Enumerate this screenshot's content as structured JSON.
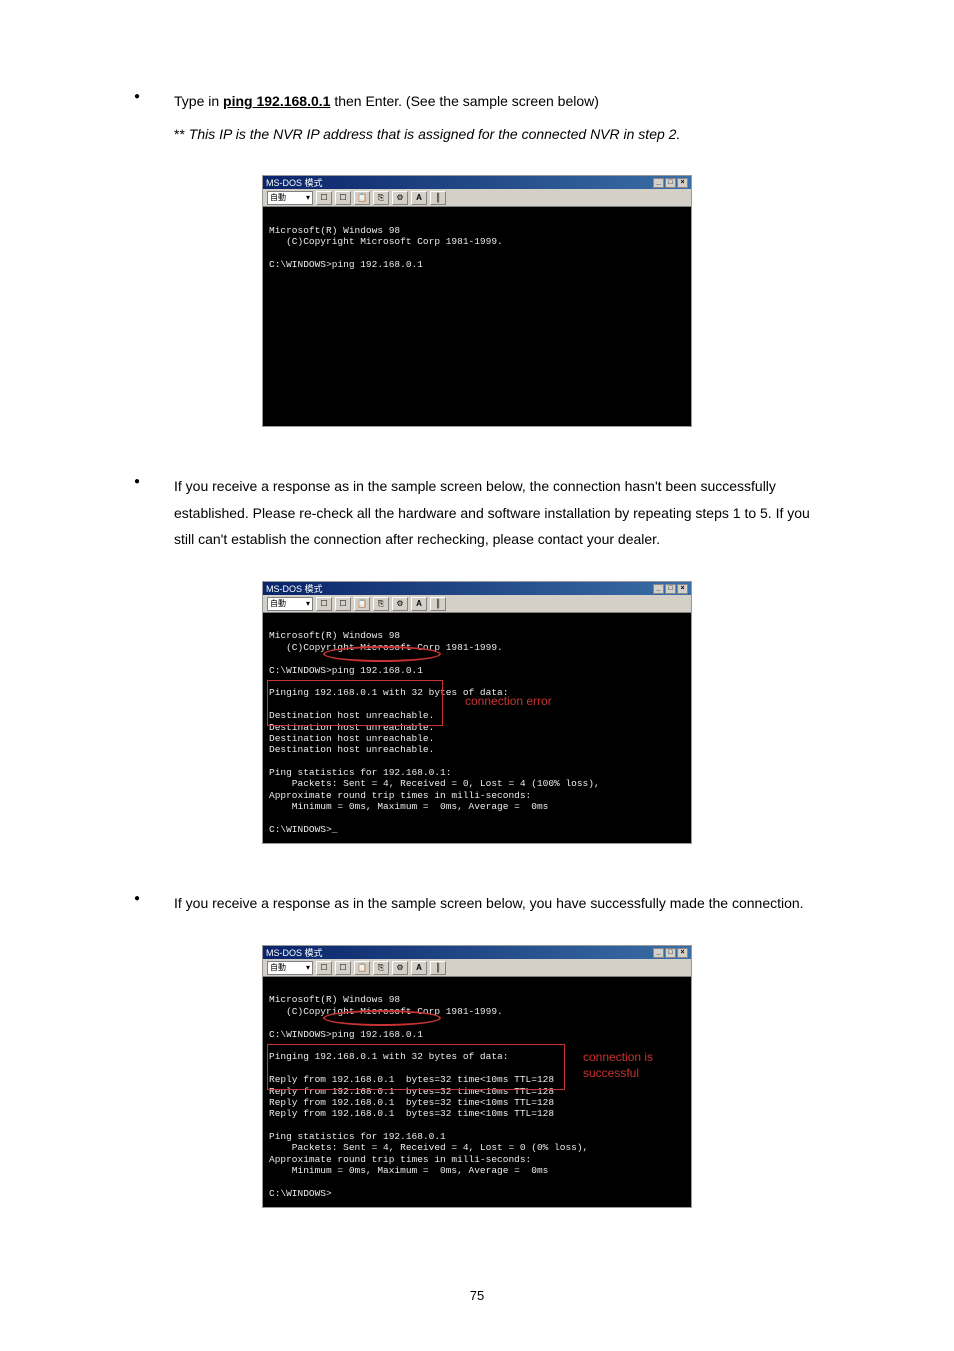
{
  "bullet1": {
    "prefix": "Type in ",
    "cmd": "ping 192.168.0.1",
    "suffix": " then Enter. (See the sample screen below)",
    "note_prefix": "** ",
    "note": "This IP is the NVR IP address that is assigned for the connected NVR in step 2."
  },
  "shot1": {
    "title": "MS-DOS 模式",
    "toolbar_sel": "自動",
    "body": "\nMicrosoft(R) Windows 98\n   (C)Copyright Microsoft Corp 1981-1999.\n\nC:\\WINDOWS>ping 192.168.0.1\n\n\n\n\n\n\n\n\n\n\n\n\n\n"
  },
  "bullet2": {
    "text": "If you receive a response as in the sample screen below, the connection hasn't been successfully established. Please re-check all the hardware and software installation by repeating steps 1 to 5. If you still can't establish the connection after rechecking, please contact your dealer."
  },
  "shot2": {
    "title": "MS-DOS 模式",
    "toolbar_sel": "自動",
    "body": "\nMicrosoft(R) Windows 98\n   (C)Copyright Microsoft Corp 1981-1999.\n\nC:\\WINDOWS>ping 192.168.0.1\n\nPinging 192.168.0.1 with 32 bytes of data:\n\nDestination host unreachable.\nDestination host unreachable.\nDestination host unreachable.\nDestination host unreachable.\n\nPing statistics for 192.168.0.1:\n    Packets: Sent = 4, Received = 0, Lost = 4 (100% loss),\nApproximate round trip times in milli-seconds:\n    Minimum = 0ms, Maximum =  0ms, Average =  0ms\n\nC:\\WINDOWS>_",
    "anno": "connection error"
  },
  "bullet3": {
    "text": "If you receive a response as in the sample screen below, you have successfully made the connection."
  },
  "shot3": {
    "title": "MS-DOS 模式",
    "toolbar_sel": "自動",
    "body": "\nMicrosoft(R) Windows 98\n   (C)Copyright Microsoft Corp 1981-1999.\n\nC:\\WINDOWS>ping 192.168.0.1\n\nPinging 192.168.0.1 with 32 bytes of data:\n\nReply from 192.168.0.1  bytes=32 time<10ms TTL=128\nReply from 192.168.0.1  bytes=32 time<10ms TTL=128\nReply from 192.168.0.1  bytes=32 time<10ms TTL=128\nReply from 192.168.0.1  bytes=32 time<10ms TTL=128\n\nPing statistics for 192.168.0.1\n    Packets: Sent = 4, Received = 4, Lost = 0 (0% loss),\nApproximate round trip times in milli-seconds:\n    Minimum = 0ms, Maximum =  0ms, Average =  0ms\n\nC:\\WINDOWS>",
    "anno1": "connection is",
    "anno2": "successful"
  },
  "page_number": "75"
}
